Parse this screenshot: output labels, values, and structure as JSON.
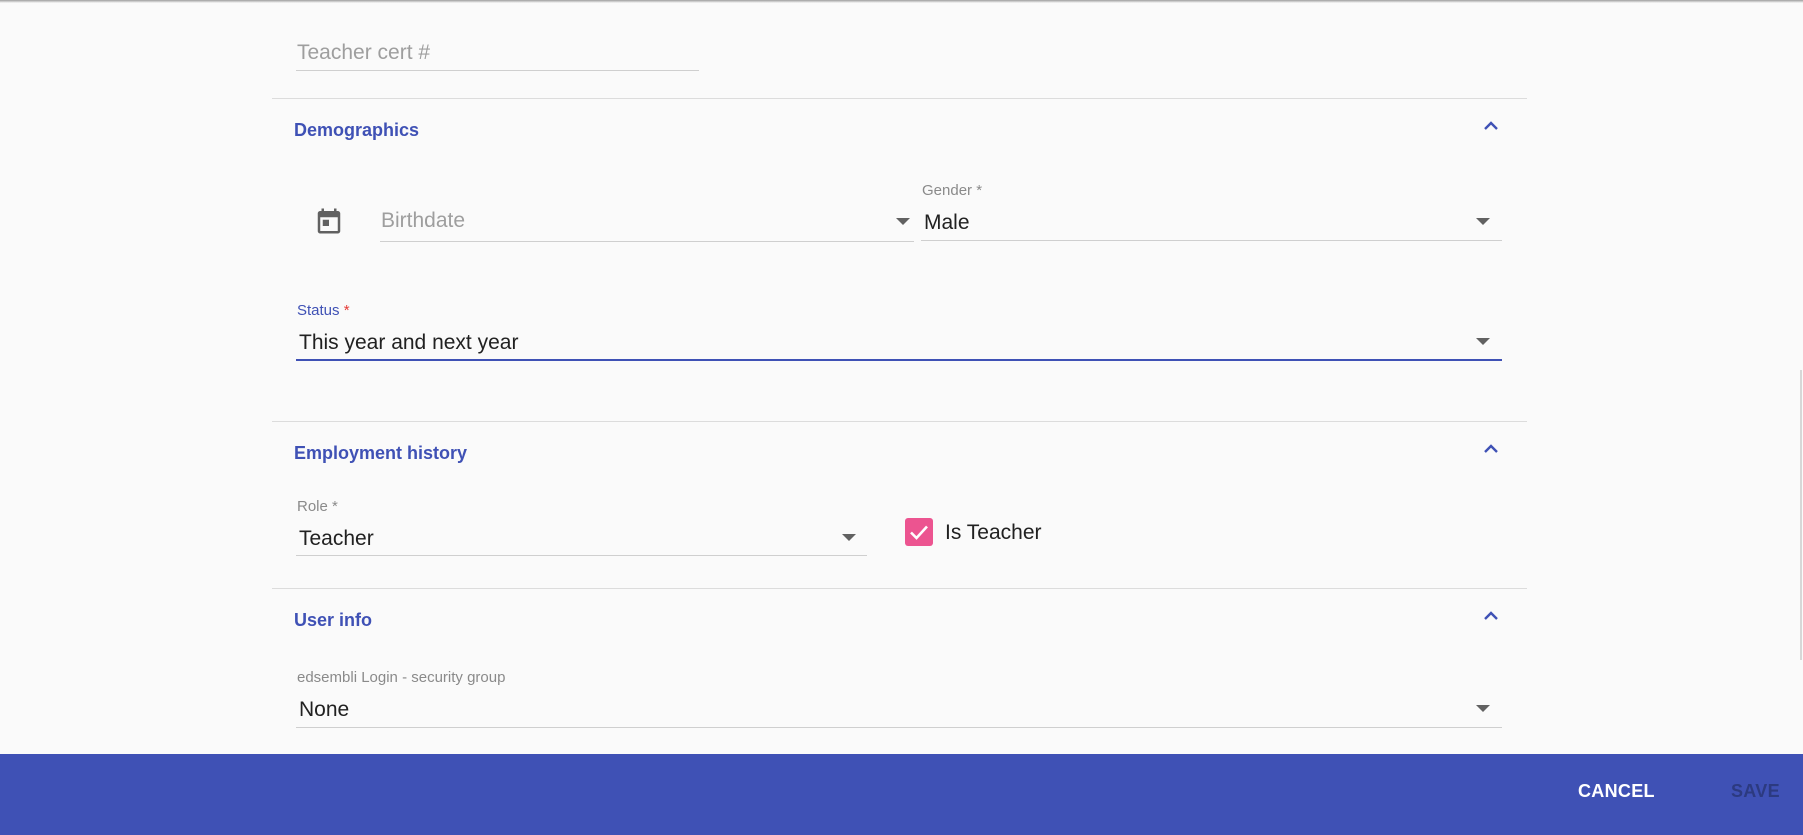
{
  "fields": {
    "teacher_cert": {
      "placeholder": "Teacher cert #"
    }
  },
  "demographics": {
    "title": "Demographics",
    "birthdate": {
      "placeholder": "Birthdate"
    },
    "gender": {
      "label": "Gender",
      "required_mark": "*",
      "value": "Male"
    },
    "status": {
      "label": "Status",
      "required_mark": "*",
      "value": "This year and next year"
    }
  },
  "employment": {
    "title": "Employment history",
    "role": {
      "label": "Role",
      "required_mark": "*",
      "value": "Teacher"
    },
    "is_teacher": {
      "label": "Is Teacher",
      "checked": true
    }
  },
  "user_info": {
    "title": "User info",
    "security_group": {
      "label": "edsembli Login - security group",
      "value": "None"
    }
  },
  "footer": {
    "cancel_label": "CANCEL",
    "save_label": "SAVE"
  },
  "colors": {
    "primary": "#3f51b5",
    "checkbox": "#ec5490",
    "background": "#fafafa"
  },
  "icons": {
    "calendar": "calendar-icon",
    "collapse": "chevron-up-icon",
    "dropdown": "caret-down-icon",
    "check": "check-icon"
  }
}
